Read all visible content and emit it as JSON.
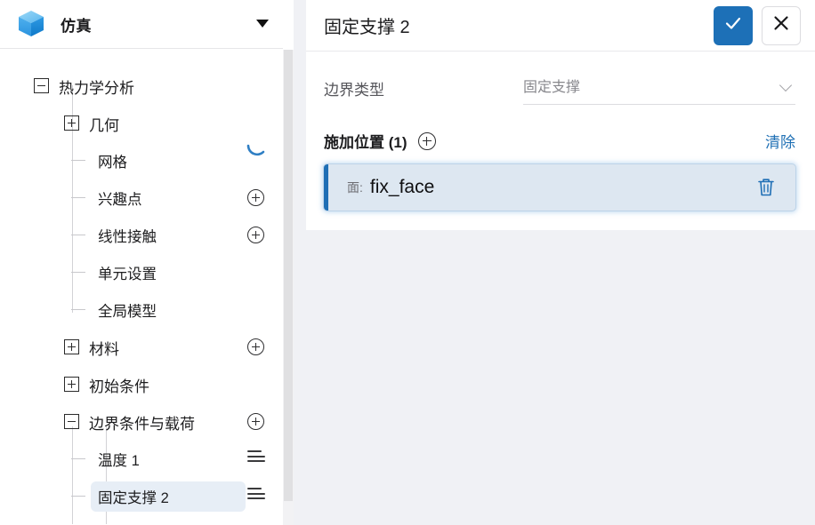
{
  "app": {
    "title": "仿真",
    "logo_icon": "cube-icon",
    "caret_icon": "caret-down-icon"
  },
  "sidebar": {
    "scrollbar": "vertical-scrollbar",
    "spinner": "loading-spinner",
    "items": [
      {
        "label": "热力学分析",
        "level": 0,
        "expander": "minus",
        "action": "none"
      },
      {
        "label": "几何",
        "level": 1,
        "expander": "plus",
        "action": "none"
      },
      {
        "label": "网格",
        "level": 2,
        "expander": "stub",
        "action": "none"
      },
      {
        "label": "兴趣点",
        "level": 2,
        "expander": "stub",
        "action": "plus-circle-icon"
      },
      {
        "label": "线性接触",
        "level": 2,
        "expander": "stub",
        "action": "plus-circle-icon"
      },
      {
        "label": "单元设置",
        "level": 2,
        "expander": "stub",
        "action": "none"
      },
      {
        "label": "全局模型",
        "level": 2,
        "expander": "stub",
        "action": "none"
      },
      {
        "label": "材料",
        "level": 1,
        "expander": "plus",
        "action": "plus-circle-icon"
      },
      {
        "label": "初始条件",
        "level": 1,
        "expander": "plus",
        "action": "none"
      },
      {
        "label": "边界条件与载荷",
        "level": 1,
        "expander": "minus",
        "action": "plus-circle-icon"
      },
      {
        "label": "温度 1",
        "level": 2,
        "expander": "stub",
        "action": "list-icon"
      },
      {
        "label": "固定支撑 2",
        "level": 2,
        "expander": "stub",
        "action": "list-icon",
        "selected": true
      }
    ]
  },
  "panel": {
    "title": "固定支撑 2",
    "confirm_label": "确认",
    "confirm_icon": "check-icon",
    "cancel_label": "取消",
    "cancel_icon": "close-icon",
    "boundary_type": {
      "label": "边界类型",
      "value": "固定支撑",
      "chevron_icon": "chevron-down-icon"
    },
    "locations": {
      "title": "施加位置 (1)",
      "add_icon": "plus-circle-icon",
      "clear_label": "清除",
      "items": [
        {
          "prefix": "面:",
          "name": "fix_face",
          "delete_icon": "trash-icon",
          "selected": true
        }
      ]
    }
  },
  "colors": {
    "accent_blue": "#1d70b7",
    "link_blue": "#2171b5",
    "selected_item_bg": "#dde7f1",
    "tree_selected_bg": "#e7eef6",
    "page_bg": "#f0f1f5"
  }
}
